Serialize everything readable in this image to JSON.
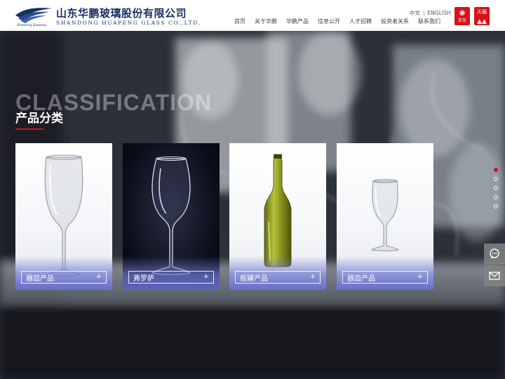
{
  "header": {
    "company_cn": "山东华鹏玻璃股份有限公司",
    "company_en": "SHANDONG HUAPENG GLASS CO.,LTD.",
    "logo_script": "Shandong Huapeng",
    "lang": {
      "cn": "中文",
      "sep": "|",
      "en": "ENGLISH"
    },
    "nav": [
      "首页",
      "关于华鹏",
      "华鹏产品",
      "信息公开",
      "人才招聘",
      "投资者关系",
      "联系我们"
    ],
    "badges": {
      "jd": {
        "label": "京东"
      },
      "tmall": {
        "label": "天猫"
      }
    }
  },
  "section": {
    "ghost_title": "CLASSIFICATION",
    "title": "产品分类"
  },
  "cards": [
    {
      "label": "器皿产品",
      "plus": "+",
      "icon": "wine-glass"
    },
    {
      "label": "弗罗萨",
      "plus": "+",
      "icon": "wine-glass-dark"
    },
    {
      "label": "瓶罐产品",
      "plus": "+",
      "icon": "wine-bottle"
    },
    {
      "label": "器皿产品",
      "plus": "+",
      "icon": "small-wine-glass"
    }
  ],
  "pagination": {
    "count": 5,
    "active_index": 0
  },
  "float_buttons": [
    "chat-icon",
    "mail-icon"
  ],
  "colors": {
    "brand_navy": "#1a2f63",
    "accent_red": "#c9161d",
    "card_bar_blue": "#6068c4"
  }
}
